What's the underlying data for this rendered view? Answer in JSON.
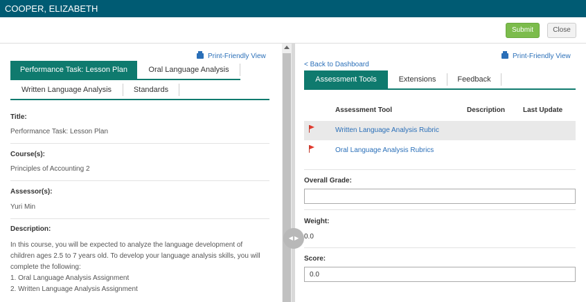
{
  "header": {
    "user_name": "COOPER, ELIZABETH"
  },
  "actions": {
    "submit_label": "Submit",
    "close_label": "Close"
  },
  "left": {
    "print_label": "Print-Friendly View",
    "tabs": [
      {
        "label": "Performance Task: Lesson Plan",
        "active": true
      },
      {
        "label": "Oral Language Analysis",
        "active": false
      },
      {
        "label": "Written Language Analysis",
        "active": false
      },
      {
        "label": "Standards",
        "active": false
      }
    ],
    "fields": [
      {
        "label": "Title:",
        "value": "Performance Task: Lesson Plan"
      },
      {
        "label": "Course(s):",
        "value": "Principles of Accounting 2"
      },
      {
        "label": "Assessor(s):",
        "value": "Yuri Min"
      }
    ],
    "description_label": "Description:",
    "description_text": "In this course, you will be expected to analyze the language development of children ages 2.5 to 7 years old. To develop your language analysis skills, you will complete the following:",
    "description_items": [
      "1.  Oral Language Analysis Assignment",
      "2.  Written Language Analysis Assignment"
    ]
  },
  "right": {
    "print_label": "Print-Friendly View",
    "back_label": "< Back to Dashboard",
    "tabs": [
      {
        "label": "Assessment Tools",
        "active": true
      },
      {
        "label": "Extensions",
        "active": false
      },
      {
        "label": "Feedback",
        "active": false
      }
    ],
    "table_headers": {
      "tool": "Assessment Tool",
      "description": "Description",
      "last_update": "Last Update"
    },
    "tools": [
      {
        "name": "Written Language Analysis Rubric"
      },
      {
        "name": "Oral Language Analysis Rubrics"
      }
    ],
    "overall_grade_label": "Overall Grade:",
    "overall_grade_value": "",
    "weight_label": "Weight:",
    "weight_value": "0.0",
    "score_label": "Score:",
    "score_value": "0.0"
  },
  "colors": {
    "header": "#005b73",
    "tab_active": "#0f7a6e",
    "submit": "#7cbc4c",
    "link": "#2a6fb8",
    "flag": "#e03b2f"
  }
}
